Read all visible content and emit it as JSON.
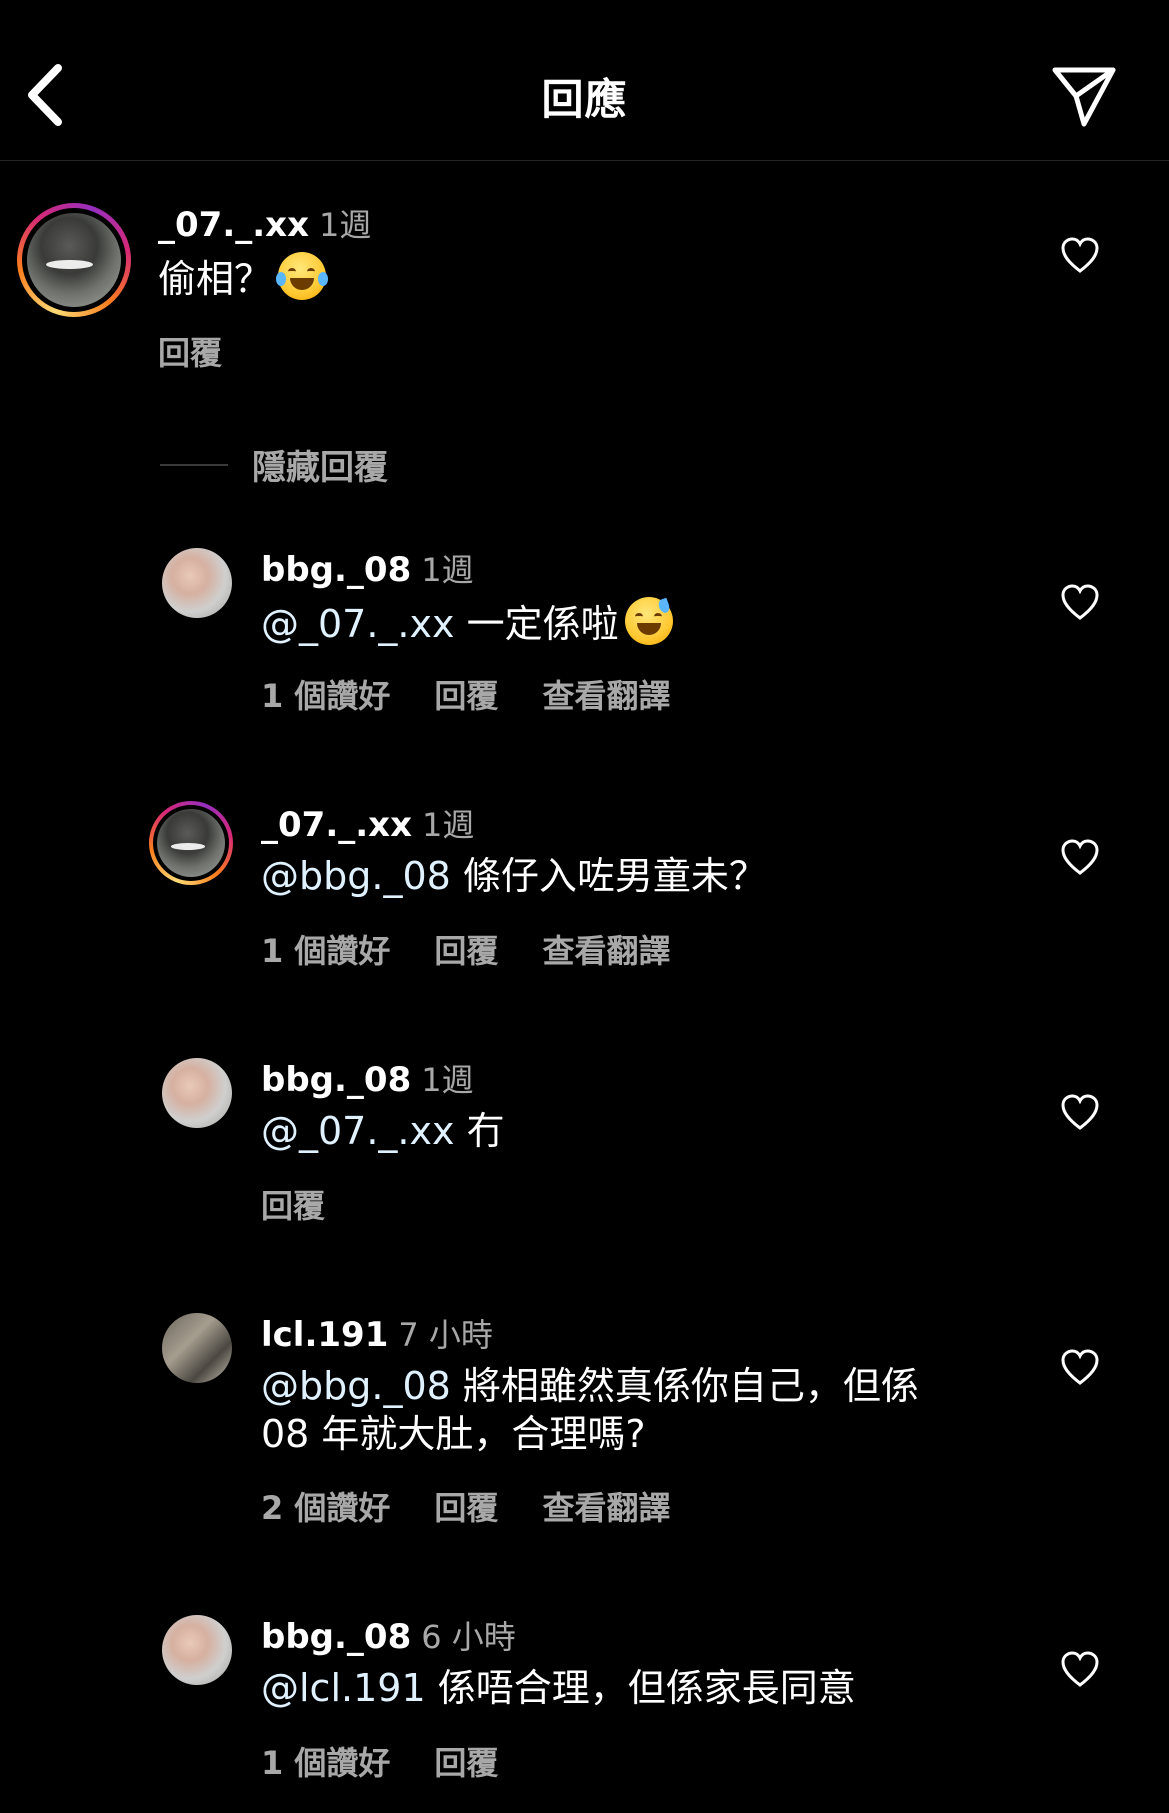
{
  "header": {
    "title": "回應",
    "back_icon": "chevron-left-icon",
    "share_icon": "send-icon"
  },
  "colors": {
    "background": "#000000",
    "text_primary": "#ffffff",
    "text_secondary": "#a8a8a8"
  },
  "parent_comment": {
    "username": "_07._.xx",
    "time": "1週",
    "text": "偷相？",
    "emoji": "face-with-tears-of-joy",
    "reply_label": "回覆"
  },
  "hide_replies_label": "隱藏回覆",
  "replies": [
    {
      "username": "bbg._08",
      "time": "1週",
      "mention": "@_07._.xx",
      "text": " 一定係啦",
      "emoji": "grinning-face-with-sweat",
      "likes": "1 個讚好",
      "reply_label": "回覆",
      "translate_label": "查看翻譯"
    },
    {
      "username": "_07._.xx",
      "time": "1週",
      "mention": "@bbg._08",
      "text": " 條仔入咗男童未？",
      "likes": "1 個讚好",
      "reply_label": "回覆",
      "translate_label": "查看翻譯"
    },
    {
      "username": "bbg._08",
      "time": "1週",
      "mention": "@_07._.xx",
      "text": " 冇",
      "reply_label": "回覆"
    },
    {
      "username": "lcl.191",
      "time": "7 小時",
      "mention": "@bbg._08",
      "text_line1": " 將相雖然真係你自己，但係",
      "text_line2": "08 年就大肚，合理嗎?",
      "likes": "2 個讚好",
      "reply_label": "回覆",
      "translate_label": "查看翻譯"
    },
    {
      "username": "bbg._08",
      "time": "6 小時",
      "mention": "@lcl.191",
      "text": " 係唔合理，但係家長同意",
      "likes": "1 個讚好",
      "reply_label": "回覆"
    }
  ]
}
